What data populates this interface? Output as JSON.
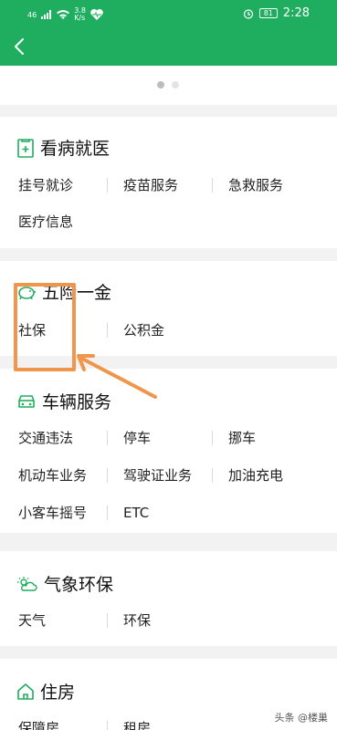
{
  "status_bar": {
    "signal": "46",
    "speed_value": "3.8",
    "speed_unit": "K/s",
    "battery": "81",
    "time": "2:28"
  },
  "sections": {
    "medical": {
      "title": "看病就医",
      "items": [
        "挂号就诊",
        "疫苗服务",
        "急救服务",
        "医疗信息"
      ]
    },
    "insurance": {
      "title": "五险一金",
      "items": [
        "社保",
        "公积金"
      ]
    },
    "vehicle": {
      "title": "车辆服务",
      "items": [
        "交通违法",
        "停车",
        "挪车",
        "机动车业务",
        "驾驶证业务",
        "加油充电",
        "小客车摇号",
        "ETC"
      ]
    },
    "weather": {
      "title": "气象环保",
      "items": [
        "天气",
        "环保"
      ]
    },
    "housing": {
      "title": "住房",
      "items": [
        "保障房",
        "租房"
      ]
    }
  },
  "watermark": {
    "text": "头条 @楼巢"
  },
  "colors": {
    "brand_green": "#1fae5f",
    "highlight_orange": "#f0964a"
  }
}
